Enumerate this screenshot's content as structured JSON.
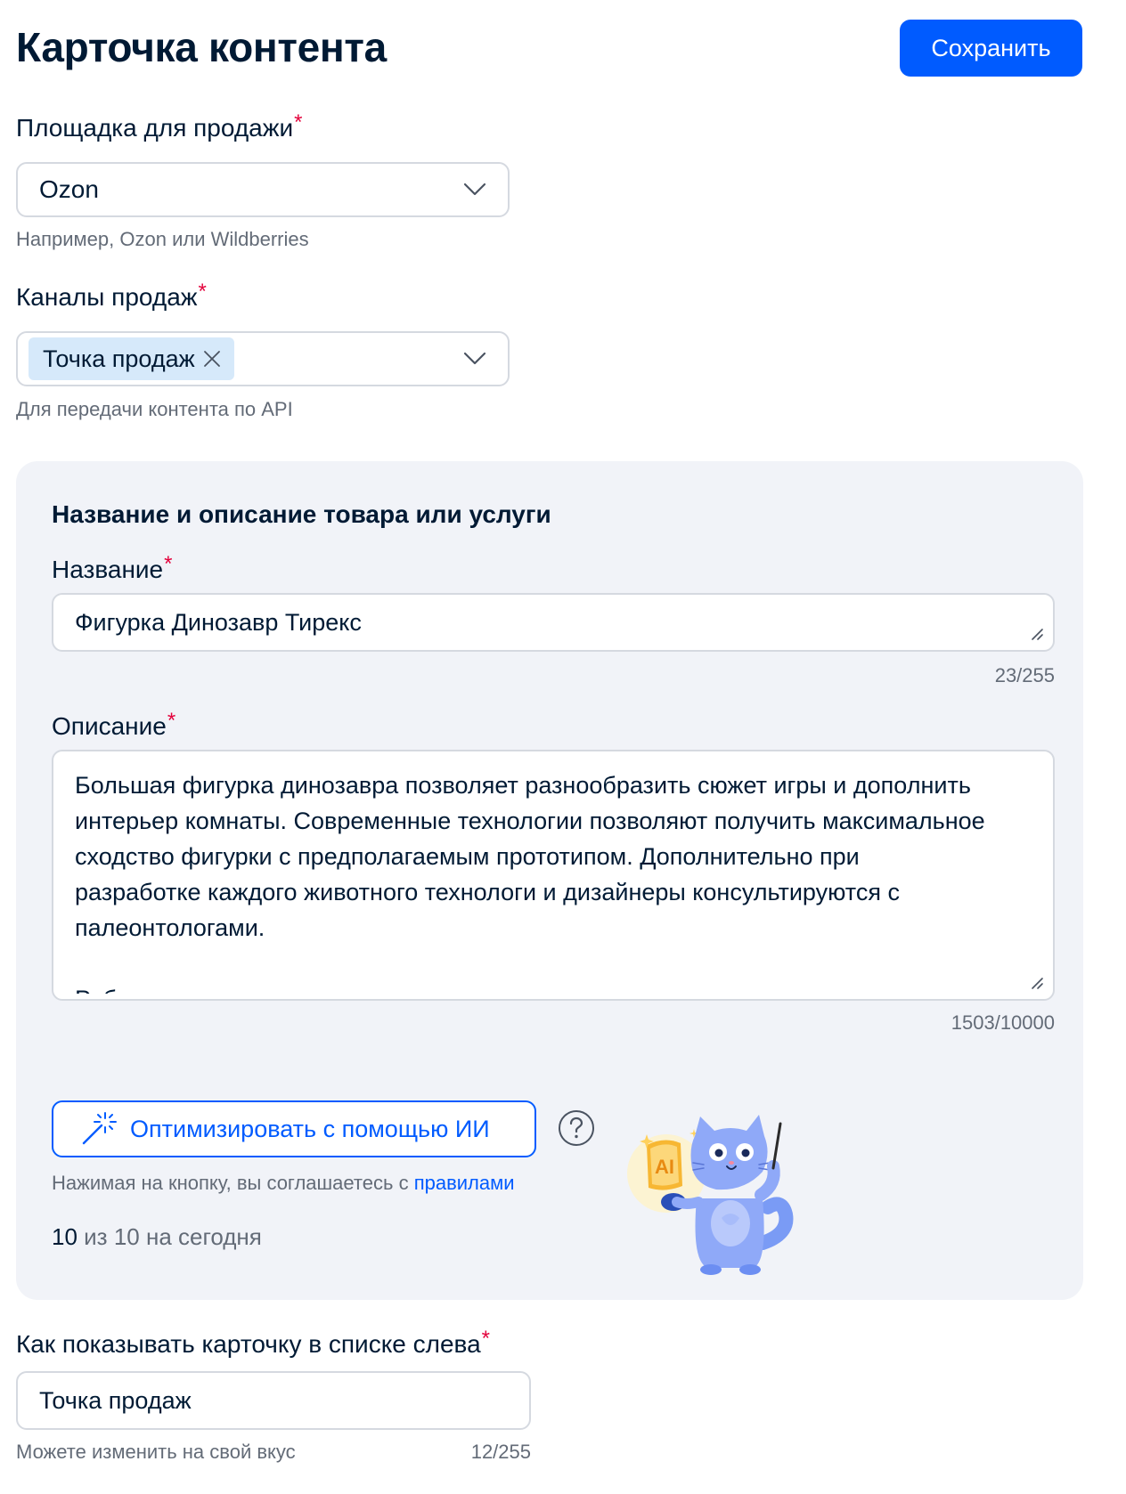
{
  "header": {
    "title": "Карточка контента",
    "save_label": "Сохранить"
  },
  "platform": {
    "label": "Площадка для продажи",
    "required_mark": "*",
    "value": "Ozon",
    "hint": "Например, Ozon или Wildberries"
  },
  "channels": {
    "label": "Каналы продаж",
    "required_mark": "*",
    "chips": [
      "Точка продаж"
    ],
    "hint": "Для передачи контента по API"
  },
  "product": {
    "section_title": "Название и описание товара или услуги",
    "name": {
      "label": "Название",
      "required_mark": "*",
      "value": "Фигурка Динозавр Тирекс",
      "counter": "23/255"
    },
    "description": {
      "label": "Описание",
      "required_mark": "*",
      "value": "Большая фигурка динозавра позволяет разнообразить сюжет игры и дополнить\nинтерьер комнаты. Современные технологии позволяют получить максимальное\nсходство фигурки с предполагаемым прототипом. Дополнительно при\nразработке каждого животного технологи и дизайнеры консультируются с\nпалеонтологами.\n\nРебенок познакомиться с доисторическим миром животных, увидит реальные",
      "counter": "1503/10000"
    },
    "ai": {
      "button_label": "Оптимизировать с помощью ИИ",
      "agree_prefix": "Нажимая на кнопку, вы соглашаетесь с ",
      "agree_link": "правилами",
      "quota_used": "10",
      "quota_rest": " из 10 на сегодня",
      "mascot_badge": "AI"
    }
  },
  "list_display": {
    "label": "Как показывать карточку в списке слева",
    "required_mark": "*",
    "value": "Точка продаж",
    "hint": "Можете изменить на свой вкус",
    "counter": "12/255"
  },
  "colors": {
    "accent": "#005bff",
    "text": "#001a34",
    "muted": "#636b77",
    "required": "#e3003b",
    "panel_bg": "#f1f3f8",
    "chip_bg": "#d6e9fa"
  }
}
